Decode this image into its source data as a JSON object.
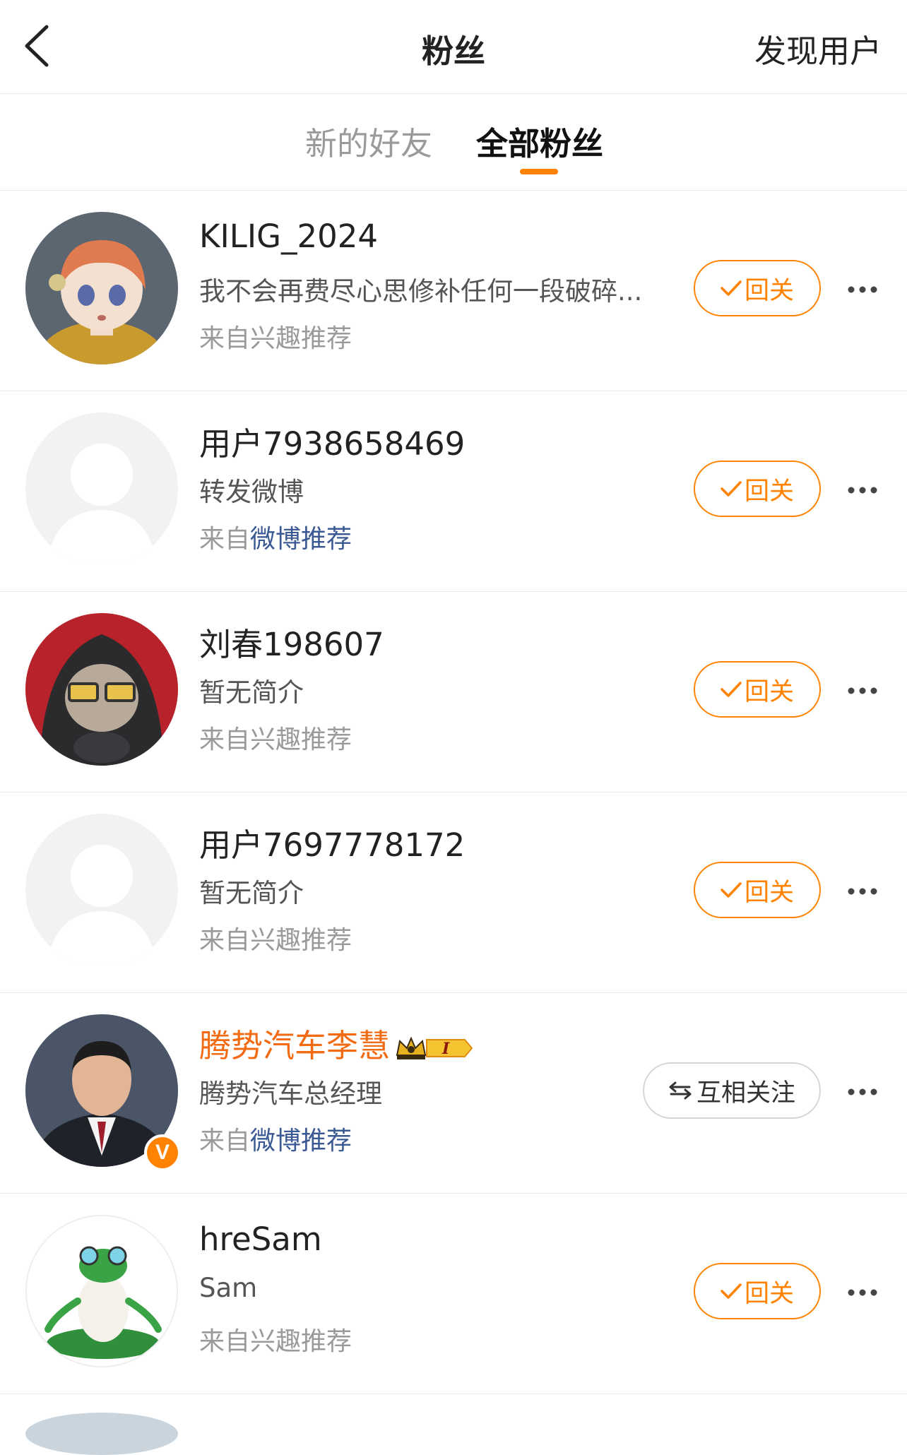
{
  "header": {
    "back_icon": "chevron-left-icon",
    "title": "粉丝",
    "discover_label": "发现用户"
  },
  "tabs": [
    {
      "label": "新的好友",
      "active": false
    },
    {
      "label": "全部粉丝",
      "active": true
    }
  ],
  "colors": {
    "accent": "#ff8200",
    "link": "#3b5a94",
    "verified_name": "#f26a12"
  },
  "fans": [
    {
      "name": "KILIG_2024",
      "bio": "我不会再费尽心思修补任何一段破碎...",
      "source_prefix": "来自",
      "source_link": "",
      "source_rest": "兴趣推荐",
      "button_label": "回关",
      "button_icon": "check-icon",
      "avatar": "anime-girl-avatar"
    },
    {
      "name": "用户7938658469",
      "bio": "转发微博",
      "source_prefix": "来自",
      "source_link": "微博推荐",
      "source_rest": "",
      "button_label": "回关",
      "button_icon": "check-icon",
      "avatar": "default-avatar"
    },
    {
      "name": "刘春198607",
      "bio": "暂无简介",
      "source_prefix": "来自",
      "source_link": "",
      "source_rest": "兴趣推荐",
      "button_label": "回关",
      "button_icon": "check-icon",
      "avatar": "hooded-cat-avatar"
    },
    {
      "name": "用户7697778172",
      "bio": "暂无简介",
      "source_prefix": "来自",
      "source_link": "",
      "source_rest": "兴趣推荐",
      "button_label": "回关",
      "button_icon": "check-icon",
      "avatar": "default-avatar"
    },
    {
      "name": "腾势汽车李慧",
      "bio": "腾势汽车总经理",
      "source_prefix": "来自",
      "source_link": "微博推荐",
      "source_rest": "",
      "button_label": "互相关注",
      "button_icon": "mutual-arrows-icon",
      "avatar": "businessman-avatar",
      "verified": true,
      "badge_icon": "crown-level-badge-icon",
      "badge_text": "I"
    },
    {
      "name": "hreSam",
      "bio": "Sam",
      "source_prefix": "来自",
      "source_link": "",
      "source_rest": "兴趣推荐",
      "button_label": "回关",
      "button_icon": "check-icon",
      "avatar": "meditating-frog-avatar"
    }
  ]
}
